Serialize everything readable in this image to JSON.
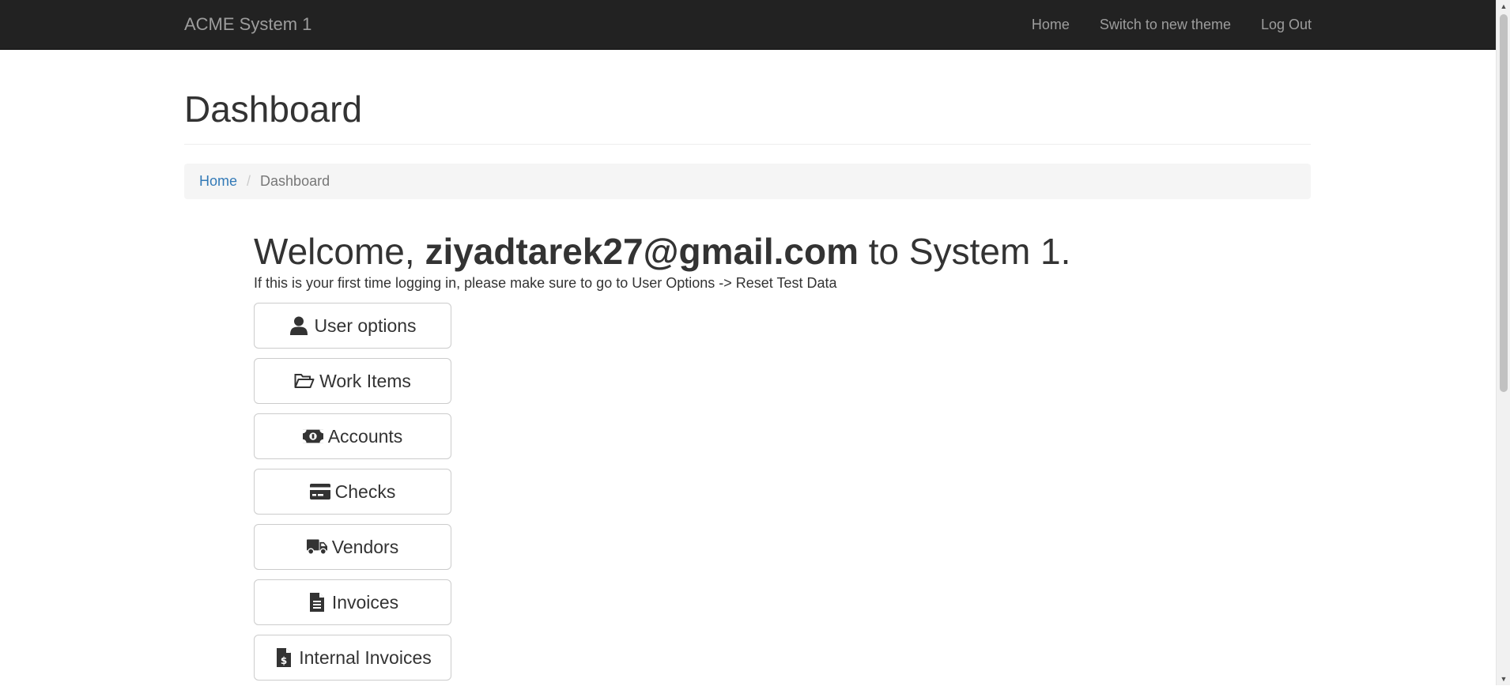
{
  "navbar": {
    "brand": "ACME System 1",
    "links": [
      "Home",
      "Switch to new theme",
      "Log Out"
    ]
  },
  "page": {
    "title": "Dashboard"
  },
  "breadcrumb": {
    "home": "Home",
    "separator": "/",
    "current": "Dashboard"
  },
  "welcome": {
    "prefix": "Welcome, ",
    "user": "ziyadtarek27@gmail.com",
    "suffix": " to System 1.",
    "notice": "If this is your first time logging in, please make sure to go to User Options -> Reset Test Data"
  },
  "menu": {
    "buttons": [
      {
        "label": "User options",
        "icon": "user-icon"
      },
      {
        "label": "Work Items",
        "icon": "folder-open-icon"
      },
      {
        "label": "Accounts",
        "icon": "money-bill-icon"
      },
      {
        "label": "Checks",
        "icon": "credit-card-icon"
      },
      {
        "label": "Vendors",
        "icon": "truck-icon"
      },
      {
        "label": "Invoices",
        "icon": "file-text-icon"
      },
      {
        "label": "Internal Invoices",
        "icon": "file-invoice-dollar-icon"
      }
    ]
  },
  "colors": {
    "navbar_bg": "#222222",
    "navbar_text": "#9d9d9d",
    "link": "#337ab7",
    "breadcrumb_bg": "#f5f5f5"
  }
}
